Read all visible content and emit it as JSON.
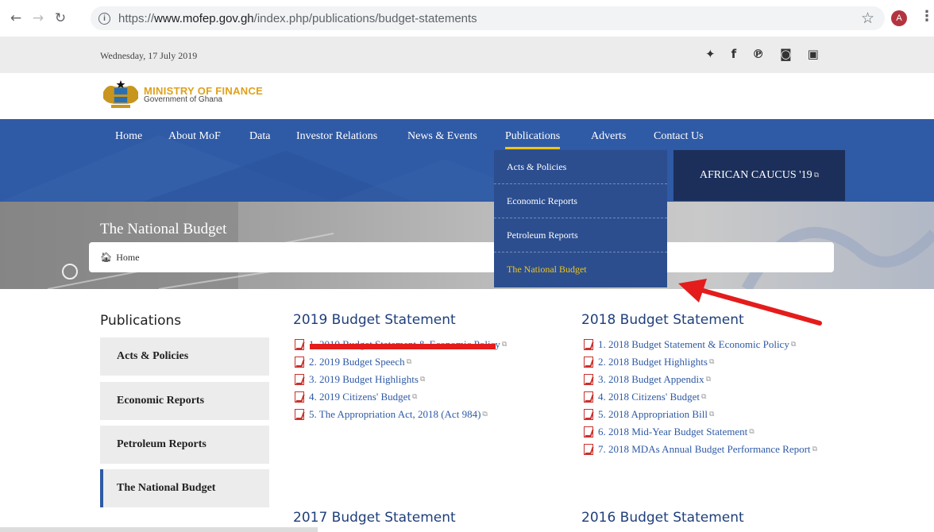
{
  "browser": {
    "url_prefix": "https://",
    "url_host": "www.mofep.gov.gh",
    "url_path": "/index.php/publications/budget-statements",
    "avatar_letter": "A"
  },
  "topbar": {
    "date": "Wednesday, 17 July 2019",
    "social": [
      "twitter-icon",
      "facebook-icon",
      "pinterest-icon",
      "instagram-icon",
      "linkedin-icon"
    ]
  },
  "logo": {
    "title": "MINISTRY OF FINANCE",
    "subtitle": "Government of Ghana"
  },
  "nav": {
    "items": [
      {
        "label": "Home"
      },
      {
        "label": "About MoF"
      },
      {
        "label": "Data"
      },
      {
        "label": "Investor Relations"
      },
      {
        "label": "News & Events"
      },
      {
        "label": "Publications"
      },
      {
        "label": "Adverts"
      },
      {
        "label": "Contact Us"
      }
    ],
    "caucus": "AFRICAN CAUCUS '19"
  },
  "dropdown": {
    "items": [
      "Acts & Policies",
      "Economic Reports",
      "Petroleum Reports",
      "The National Budget"
    ]
  },
  "banner": {
    "title": "The National Budget",
    "breadcrumb": "Home"
  },
  "sidebar": {
    "heading": "Publications",
    "items": [
      "Acts & Policies",
      "Economic Reports",
      "Petroleum Reports",
      "The National Budget"
    ]
  },
  "content": {
    "col2019": {
      "heading": "2019 Budget Statement",
      "docs": [
        "1. 2019 Budget Statement & Economic Policy",
        "2. 2019 Budget Speech",
        "3. 2019 Budget Highlights",
        "4. 2019 Citizens' Budget",
        "5. The Appropriation Act, 2018 (Act 984)"
      ]
    },
    "col2018": {
      "heading": "2018 Budget Statement",
      "docs": [
        "1. 2018 Budget Statement & Economic Policy",
        "2. 2018 Budget Highlights",
        "3. 2018 Budget Appendix",
        "4. 2018 Citizens' Budget",
        "5. 2018 Appropriation Bill",
        "6. 2018 Mid-Year Budget Statement",
        "7. 2018 MDAs Annual Budget Performance Report"
      ]
    },
    "col2017": {
      "heading": "2017 Budget Statement"
    },
    "col2016": {
      "heading": "2016 Budget Statement"
    }
  },
  "colors": {
    "nav_blue": "#2f5aa5",
    "dropdown_blue": "#2c4e8f",
    "caucus_navy": "#1c2f5a",
    "accent_yellow": "#f0c419",
    "annotation_red": "#e41c1c"
  }
}
